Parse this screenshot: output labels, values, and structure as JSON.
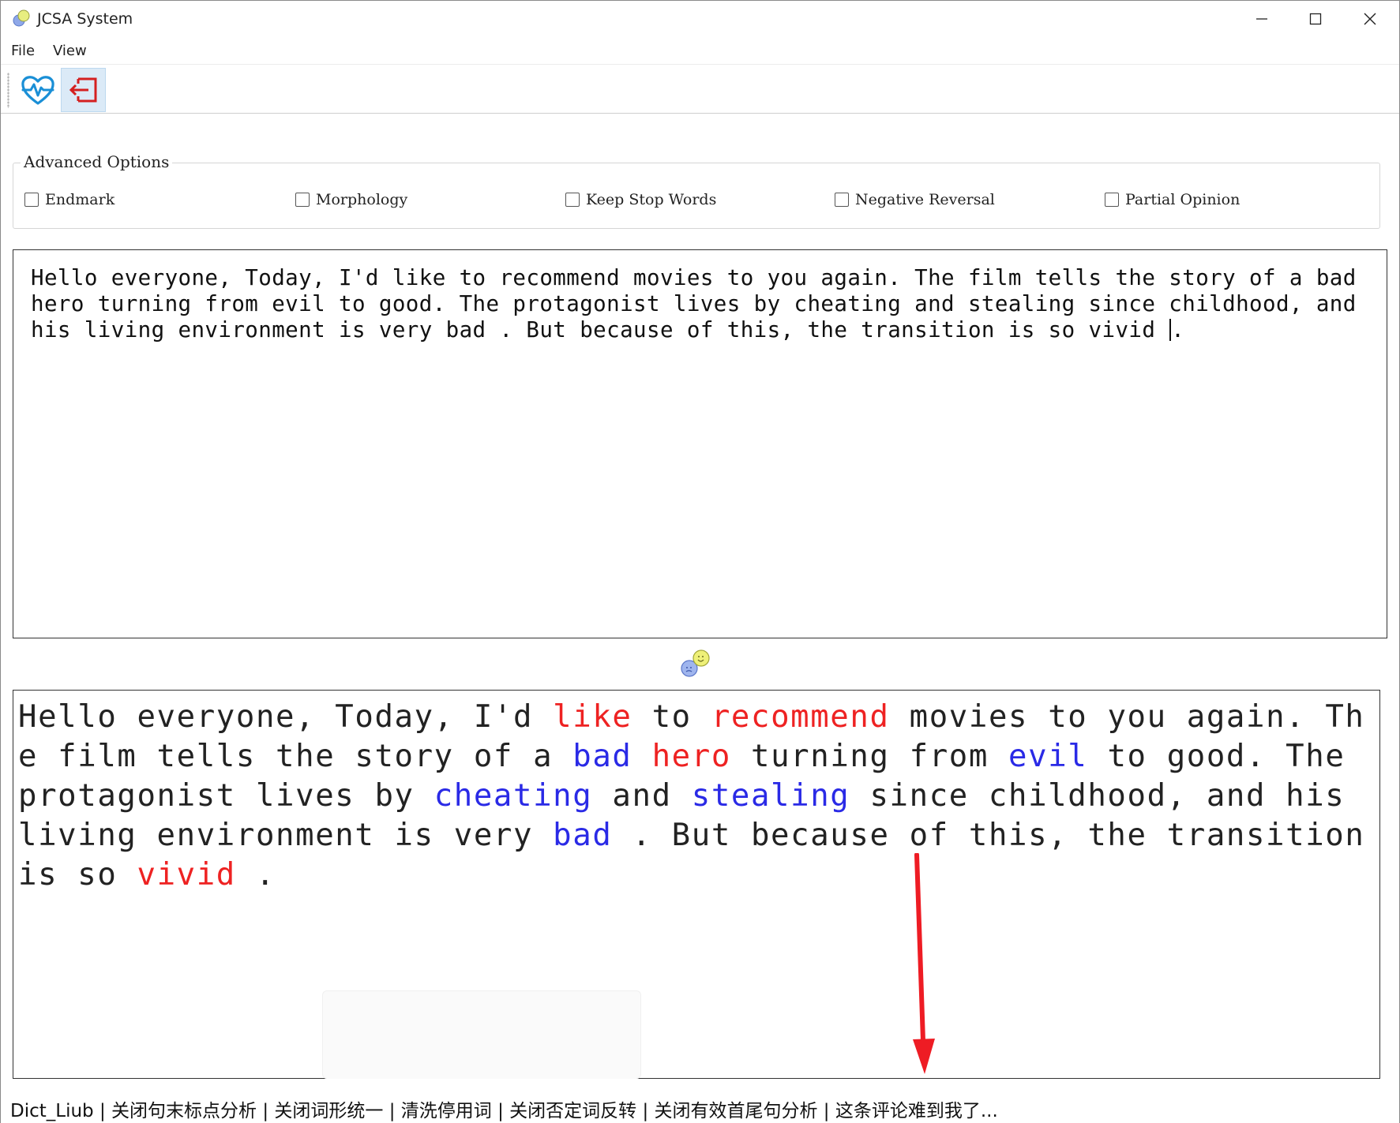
{
  "window": {
    "title": "JCSA System"
  },
  "menu": {
    "file": "File",
    "view": "View"
  },
  "toolbar": {
    "health_icon": "heartbeat-icon",
    "exit_icon": "exit-icon"
  },
  "options": {
    "title": "Advanced Options",
    "items": [
      {
        "label": "Endmark",
        "checked": false
      },
      {
        "label": "Morphology",
        "checked": false
      },
      {
        "label": "Keep Stop Words",
        "checked": false
      },
      {
        "label": "Negative Reversal",
        "checked": false
      },
      {
        "label": "Partial Opinion",
        "checked": false
      }
    ]
  },
  "input": {
    "text": "Hello everyone, Today, I'd like to recommend movies to you again. The film tells the story of a bad\nhero turning from evil to good. The protagonist lives by cheating and stealing since childhood, and\nhis living environment is very bad . But because of this, the transition is so vivid ",
    "caret_char": "."
  },
  "output": {
    "colors": {
      "positive": "#ee2222",
      "negative": "#2a2ae6",
      "neutral": "#222222"
    },
    "tokens": [
      {
        "t": " Hello everyone, Today, I'd ",
        "s": "n"
      },
      {
        "t": "like",
        "s": "p"
      },
      {
        "t": " to ",
        "s": "n"
      },
      {
        "t": "recommend",
        "s": "p"
      },
      {
        "t": " movies to you again. The film tells the story of a ",
        "s": "n"
      },
      {
        "t": "bad",
        "s": "g"
      },
      {
        "t": " ",
        "s": "n"
      },
      {
        "t": "hero",
        "s": "p"
      },
      {
        "t": " turning from ",
        "s": "n"
      },
      {
        "t": "evil",
        "s": "g"
      },
      {
        "t": " to good. The protagonist lives by ",
        "s": "n"
      },
      {
        "t": "cheating",
        "s": "g"
      },
      {
        "t": " and ",
        "s": "n"
      },
      {
        "t": "stealing",
        "s": "g"
      },
      {
        "t": " since childhood, and his living environment is very ",
        "s": "n"
      },
      {
        "t": "bad",
        "s": "g"
      },
      {
        "t": " . But because of this, the transition is so ",
        "s": "n"
      },
      {
        "t": "vivid",
        "s": "p"
      },
      {
        "t": " .",
        "s": "n"
      }
    ]
  },
  "status": {
    "text": "Dict_Liub | 关闭句末标点分析 | 关闭词形统一 | 清洗停用词 | 关闭否定词反转 | 关闭有效首尾句分析 | 这条评论难到我了..."
  }
}
